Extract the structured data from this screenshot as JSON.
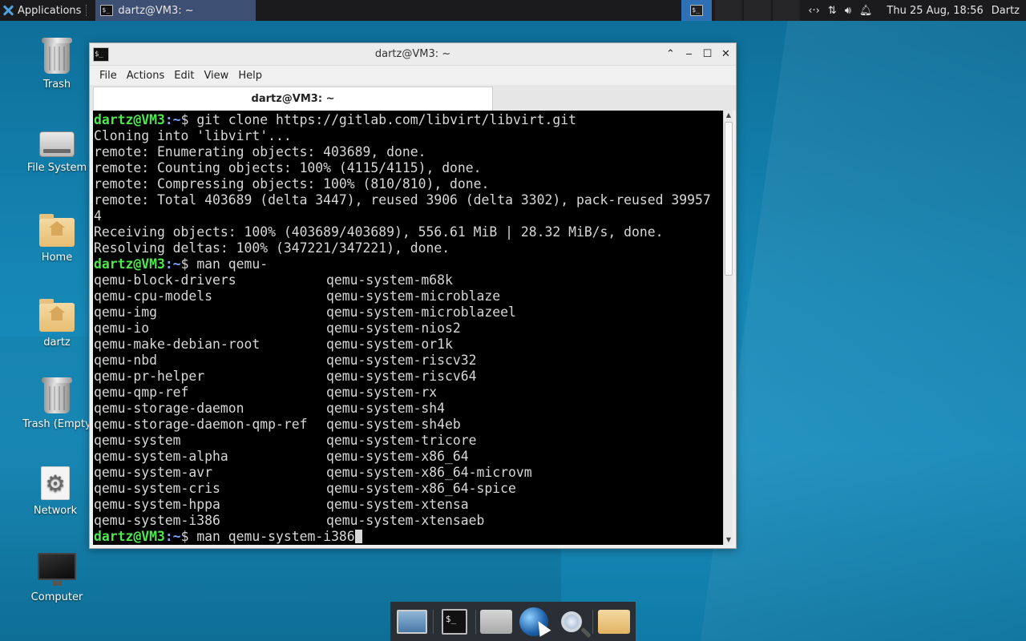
{
  "top_panel": {
    "apps_label": "Applications",
    "task_title": "dartz@VM3: ~",
    "clock": "Thu 25 Aug, 18:56",
    "user": "Dartz"
  },
  "desktop": {
    "icons": [
      {
        "label": "Trash",
        "icon": "trash-icon"
      },
      {
        "label": "File System",
        "icon": "drive-icon"
      },
      {
        "label": "Home",
        "icon": "home-folder-icon"
      },
      {
        "label": "dartz",
        "icon": "home-folder-icon"
      },
      {
        "label": "Trash (Empty",
        "icon": "trash-icon"
      },
      {
        "label": "Network",
        "icon": "gear-icon"
      },
      {
        "label": "Computer",
        "icon": "monitor-icon"
      }
    ]
  },
  "window": {
    "title": "dartz@VM3: ~",
    "menu": [
      "File",
      "Actions",
      "Edit",
      "View",
      "Help"
    ],
    "tab": "dartz@VM3: ~"
  },
  "terminal": {
    "prompt_user": "dartz@VM3",
    "prompt_path": ":~",
    "prompt_suffix": "$ ",
    "cmd1": "git clone https://gitlab.com/libvirt/libvirt.git",
    "output": [
      "Cloning into 'libvirt'...",
      "remote: Enumerating objects: 403689, done.",
      "remote: Counting objects: 100% (4115/4115), done.",
      "remote: Compressing objects: 100% (810/810), done.",
      "remote: Total 403689 (delta 3447), reused 3906 (delta 3302), pack-reused 39957",
      "4",
      "Receiving objects: 100% (403689/403689), 556.61 MiB | 28.32 MiB/s, done.",
      "Resolving deltas: 100% (347221/347221), done."
    ],
    "cmd2": "man qemu-",
    "completions": [
      [
        "qemu-block-drivers",
        "qemu-system-m68k"
      ],
      [
        "qemu-cpu-models",
        "qemu-system-microblaze"
      ],
      [
        "qemu-img",
        "qemu-system-microblazeel"
      ],
      [
        "qemu-io",
        "qemu-system-nios2"
      ],
      [
        "qemu-make-debian-root",
        "qemu-system-or1k"
      ],
      [
        "qemu-nbd",
        "qemu-system-riscv32"
      ],
      [
        "qemu-pr-helper",
        "qemu-system-riscv64"
      ],
      [
        "qemu-qmp-ref",
        "qemu-system-rx"
      ],
      [
        "qemu-storage-daemon",
        "qemu-system-sh4"
      ],
      [
        "qemu-storage-daemon-qmp-ref",
        "qemu-system-sh4eb"
      ],
      [
        "qemu-system",
        "qemu-system-tricore"
      ],
      [
        "qemu-system-alpha",
        "qemu-system-x86_64"
      ],
      [
        "qemu-system-avr",
        "qemu-system-x86_64-microvm"
      ],
      [
        "qemu-system-cris",
        "qemu-system-x86_64-spice"
      ],
      [
        "qemu-system-hppa",
        "qemu-system-xtensa"
      ],
      [
        "qemu-system-i386",
        "qemu-system-xtensaeb"
      ]
    ],
    "cmd3": "man qemu-system-i386"
  },
  "dock": {
    "items": [
      "desktop-icon",
      "terminal-icon",
      "home-folder-icon",
      "web-browser-icon",
      "search-icon",
      "folder-icon"
    ]
  },
  "colors": {
    "prompt_user": "#4ee84e",
    "prompt_path": "#7aa7ff",
    "terminal_bg": "#000000",
    "panel_bg": "#1b1b1d"
  }
}
